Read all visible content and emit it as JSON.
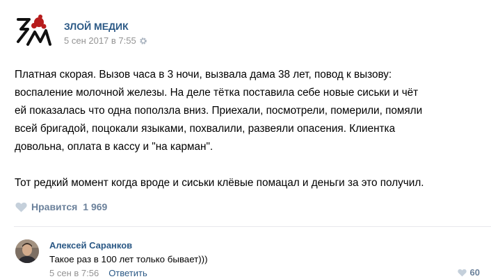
{
  "post": {
    "author": "ЗЛОЙ МЕДИК",
    "date": "5 сен 2017 в 7:55",
    "text_lines": [
      "Платная скорая. Вызов часа в 3 ночи, вызвала дама 38 лет, повод к вызову:",
      "воспаление молочной железы. На деле тётка поставила себе новые сиськи и чёт",
      "ей показалась что одна поползла вниз. Приехали, посмотрели, померили, помяли",
      "всей бригадой, поцокали языками, похвалили, развеяли опасения. Клиентка",
      "довольна, оплата в кассу и \"на карман\".",
      "Тот редкий момент когда вроде и сиськи клёвые помацал и деньги за это получил."
    ],
    "likes_label": "Нравится",
    "likes_count": "1 969",
    "icons": {
      "logo": "logo-icon",
      "settings": "gear-icon",
      "like": "heart-icon"
    }
  },
  "comment": {
    "author": "Алексей Саранков",
    "text": "Такое раз в 100 лет только бывает)))",
    "date": "5 сен в 7:56",
    "reply_label": "Ответить",
    "likes_count": "60"
  },
  "colors": {
    "link": "#2a5885",
    "muted": "#939393",
    "like": "#6b819b",
    "logo_accent": "#b71c1c"
  }
}
